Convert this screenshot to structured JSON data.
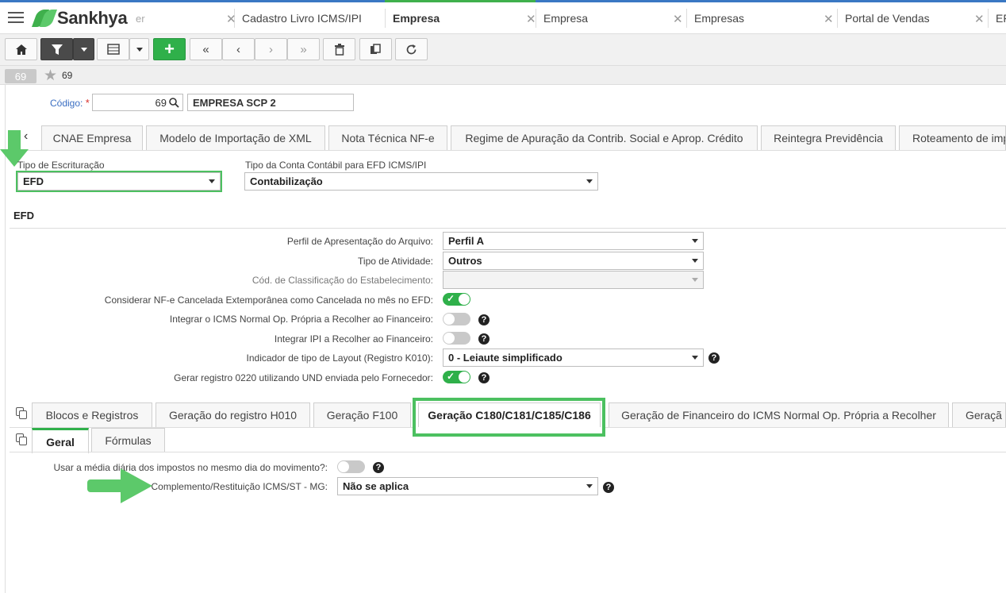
{
  "app": {
    "brand": "Sankhya",
    "brand_sub": "er"
  },
  "top_tabs": [
    {
      "label": "Cadastro Livro ICMS/IPI"
    },
    {
      "label": "Empresa"
    },
    {
      "label": "Empresa"
    },
    {
      "label": "Empresas"
    },
    {
      "label": "Portal de Vendas"
    },
    {
      "label": "EF"
    }
  ],
  "record": {
    "badge": "69",
    "number": "69"
  },
  "codigo": {
    "label": "Código:",
    "required": "*",
    "value": "69",
    "name": "EMPRESA SCP 2"
  },
  "upper_tabs": [
    {
      "label": "CNAE Empresa"
    },
    {
      "label": "Modelo de Importação de XML"
    },
    {
      "label": "Nota Técnica NF-e"
    },
    {
      "label": "Regime de Apuração da Contrib. Social e Aprop. Crédito"
    },
    {
      "label": "Reintegra Previdência"
    },
    {
      "label": "Roteamento de imp"
    }
  ],
  "tipo_escrituracao": {
    "label": "Tipo de Escrituração",
    "value": "EFD"
  },
  "tipo_conta": {
    "label": "Tipo da Conta Contábil para EFD ICMS/IPI",
    "value": "Contabilização"
  },
  "efd": {
    "title": "EFD",
    "perfil": {
      "label": "Perfil de Apresentação do Arquivo:",
      "value": "Perfil A"
    },
    "atividade": {
      "label": "Tipo de Atividade:",
      "value": "Outros"
    },
    "classificacao": {
      "label": "Cód. de Classificação do Estabelecimento:",
      "value": ""
    },
    "nfe_cancelada": {
      "label": "Considerar NF-e Cancelada Extemporânea como Cancelada no mês no EFD:",
      "on": true
    },
    "icms_normal": {
      "label": "Integrar o ICMS Normal Op. Própria a Recolher ao Financeiro:",
      "on": false
    },
    "ipi": {
      "label": "Integrar IPI a Recolher ao Financeiro:",
      "on": false
    },
    "layout": {
      "label": "Indicador de tipo de Layout (Registro K010):",
      "value": "0 - Leiaute simplificado"
    },
    "registro_0220": {
      "label": "Gerar registro 0220 utilizando UND enviada pelo Fornecedor:",
      "on": true
    }
  },
  "lower_tabs": [
    {
      "label": "Blocos e Registros"
    },
    {
      "label": "Geração do registro H010"
    },
    {
      "label": "Geração F100"
    },
    {
      "label": "Geração C180/C181/C185/C186"
    },
    {
      "label": "Geração de Financeiro do ICMS Normal Op. Própria a Recolher"
    },
    {
      "label": "Geraçã"
    }
  ],
  "sub_tabs": [
    {
      "label": "Geral"
    },
    {
      "label": "Fórmulas"
    }
  ],
  "geral": {
    "media": {
      "label": "Usar a média diária dos impostos no mesmo dia do movimento?:",
      "on": false
    },
    "complemento": {
      "label": "Complemento/Restituição ICMS/ST - MG:",
      "value": "Não se aplica"
    }
  },
  "colors": {
    "accent": "#2fb04a",
    "highlight": "#4cc060",
    "link": "#3a6ec2"
  },
  "icons": {
    "help": "?",
    "search": "search-icon"
  }
}
